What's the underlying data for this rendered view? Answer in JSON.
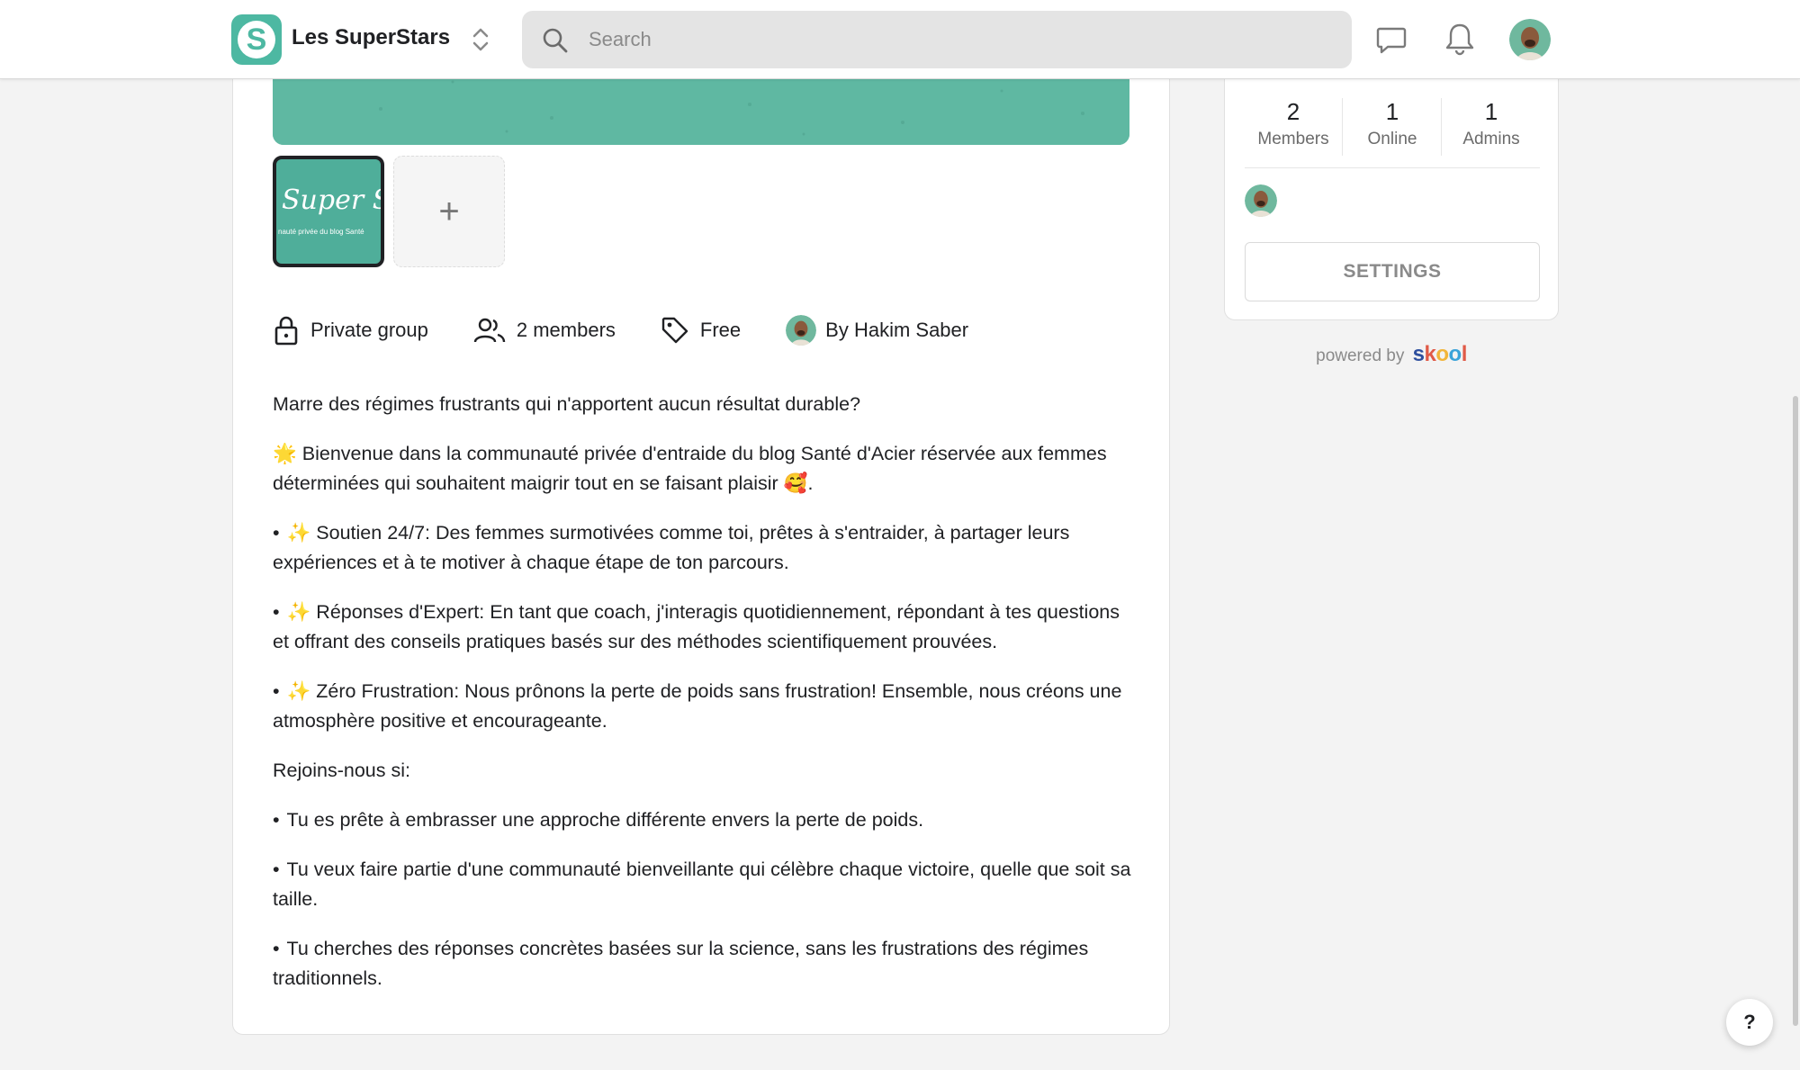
{
  "header": {
    "group_name": "Les SuperStars",
    "search_placeholder": "Search"
  },
  "thumbnails": {
    "main_script": "Super St",
    "main_tagline": "nauté privée du blog Santé",
    "add_label": "+"
  },
  "meta": {
    "privacy": "Private group",
    "members": "2 members",
    "price": "Free",
    "owner": "By Hakim Saber"
  },
  "description": {
    "intro": "Marre des régimes frustrants qui n'apportent aucun résultat durable?",
    "welcome_emoji": "🌟",
    "welcome": "Bienvenue dans la communauté privée d'entraide du blog Santé d'Acier réservée aux femmes déterminées qui souhaitent maigrir tout en se faisant plaisir",
    "welcome_end_emoji": "🥰",
    "welcome_end": ".",
    "bullets_1": [
      {
        "emoji": "✨",
        "text": "Soutien 24/7: Des femmes surmotivées comme toi, prêtes à s'entraider, à partager leurs expériences et à te motiver à chaque étape de ton parcours."
      },
      {
        "emoji": "✨",
        "text": "Réponses d'Expert: En tant que coach, j'interagis quotidiennement, répondant à tes questions et offrant des conseils pratiques basés sur des méthodes scientifiquement prouvées."
      },
      {
        "emoji": "✨",
        "text": "Zéro Frustration: Nous prônons la perte de poids sans frustration! Ensemble, nous créons une atmosphère positive et encourageante."
      }
    ],
    "join_title": "Rejoins-nous si:",
    "bullets_2": [
      "Tu es prête à embrasser une approche différente envers la perte de poids.",
      "Tu veux faire partie d'une communauté bienveillante qui célèbre chaque victoire, quelle que soit sa taille.",
      "Tu cherches des réponses concrètes basées sur la science, sans les frustrations des régimes traditionnels."
    ]
  },
  "stats": {
    "members_num": "2",
    "members_label": "Members",
    "online_num": "1",
    "online_label": "Online",
    "admins_num": "1",
    "admins_label": "Admins"
  },
  "sidebar": {
    "settings_label": "SETTINGS",
    "powered_by": "powered by",
    "brand": "skool"
  },
  "help_label": "?",
  "colors": {
    "accent": "#4db8a2",
    "banner": "#5fb8a2"
  }
}
